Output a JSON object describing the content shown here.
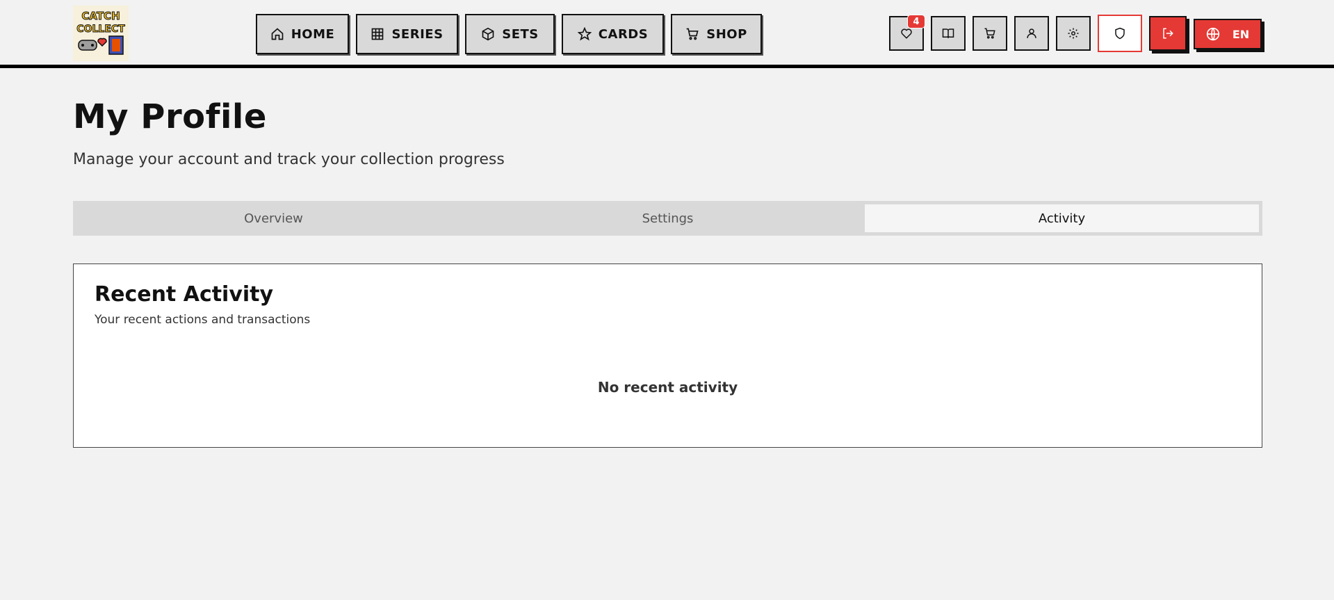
{
  "brand": {
    "logo_text_line1": "CATCH",
    "logo_text_line2": "COLLECT"
  },
  "nav": [
    {
      "label": "HOME",
      "icon": "home-icon"
    },
    {
      "label": "SERIES",
      "icon": "grid-icon"
    },
    {
      "label": "SETS",
      "icon": "box-icon"
    },
    {
      "label": "CARDS",
      "icon": "star-icon"
    },
    {
      "label": "SHOP",
      "icon": "cart-icon"
    }
  ],
  "header_icons": {
    "wishlist_icon": "heart-icon",
    "wishlist_badge": "4",
    "collection_icon": "book-icon",
    "cart_icon": "cart-icon",
    "profile_icon": "user-icon",
    "settings_icon": "gear-icon",
    "admin_icon": "shield-icon",
    "logout_icon": "logout-icon",
    "language_icon": "globe-icon",
    "language_label": "EN"
  },
  "page": {
    "title": "My Profile",
    "subtitle": "Manage your account and track your collection progress"
  },
  "tabs": [
    {
      "label": "Overview",
      "active": false
    },
    {
      "label": "Settings",
      "active": false
    },
    {
      "label": "Activity",
      "active": true
    }
  ],
  "activity": {
    "title": "Recent Activity",
    "description": "Your recent actions and transactions",
    "empty_message": "No recent activity"
  },
  "colors": {
    "accent": "#e53935",
    "background": "#f2f2f2",
    "button_bg": "#d9d9d9"
  }
}
